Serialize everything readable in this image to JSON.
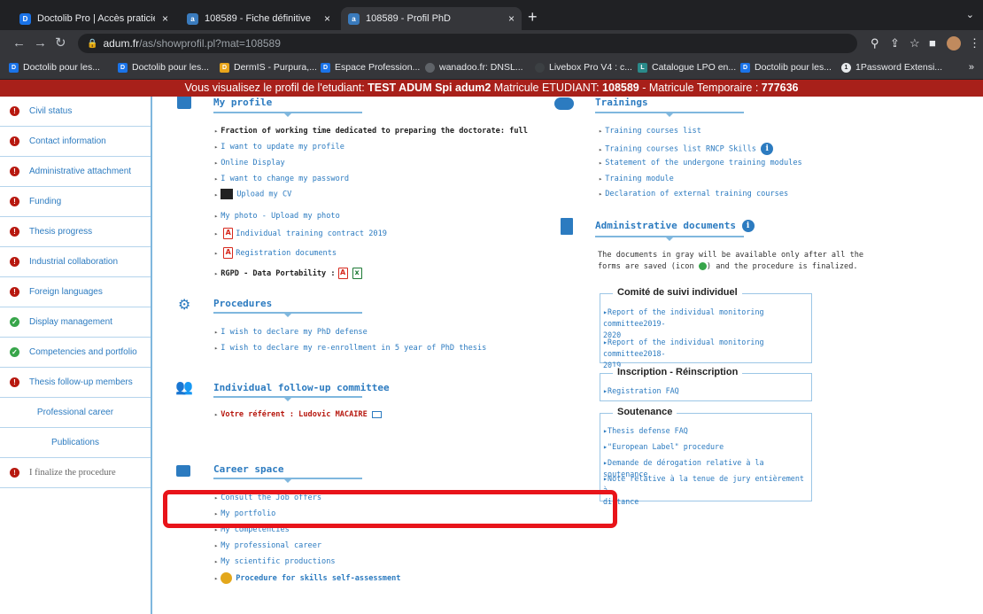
{
  "browser": {
    "tabs": [
      {
        "title": "Doctolib Pro | Accès praticiens",
        "active": false
      },
      {
        "title": "108589 - Fiche définitive",
        "active": false
      },
      {
        "title": "108589 - Profil PhD",
        "active": true
      }
    ],
    "url_host": "adum.fr",
    "url_path": "/as/showprofil.pl?mat=108589",
    "bookmarks": [
      "Doctolib pour les...",
      "Doctolib pour les...",
      "DermIS - Purpura,...",
      "Espace Profession...",
      "wanadoo.fr: DNSL...",
      "Livebox Pro V4 : c...",
      "Catalogue LPO en...",
      "Doctolib pour les...",
      "1Password Extensi..."
    ]
  },
  "banner": {
    "prefix": "Vous visualisez le profil de l'etudiant:",
    "student": "TEST ADUM Spi adum2",
    "matricule_label": "Matricule ETUDIANT:",
    "matricule": "108589",
    "temp_label": "- Matricule Temporaire :",
    "temp": "777636"
  },
  "sidebar": {
    "items": [
      {
        "label": "Civil status",
        "status": "red"
      },
      {
        "label": "Contact information",
        "status": "red"
      },
      {
        "label": "Administrative attachment",
        "status": "red"
      },
      {
        "label": "Funding",
        "status": "red"
      },
      {
        "label": "Thesis progress",
        "status": "red"
      },
      {
        "label": "Industrial collaboration",
        "status": "red"
      },
      {
        "label": "Foreign languages",
        "status": "red"
      },
      {
        "label": "Display management",
        "status": "green"
      },
      {
        "label": "Competencies and portfolio",
        "status": "green"
      },
      {
        "label": "Thesis follow-up members",
        "status": "red"
      },
      {
        "label": "Professional career",
        "status": "none"
      },
      {
        "label": "Publications",
        "status": "none"
      },
      {
        "label": "I finalize the procedure",
        "status": "red"
      }
    ]
  },
  "profile": {
    "title": "My profile",
    "fraction": "Fraction of working time dedicated to preparing the doctorate: full",
    "links": [
      "I want to update my profile",
      "Online Display",
      "I want to change my password"
    ],
    "upload_cv": "Upload my CV",
    "photo": "My photo - Upload my photo",
    "contract": "Individual training contract 2019",
    "registration": "Registration documents",
    "rgpd": "RGPD - Data Portability :"
  },
  "procedures": {
    "title": "Procedures",
    "links": [
      "I wish to declare my PhD defense",
      "I wish to declare my re-enrollment in 5 year of PhD thesis"
    ]
  },
  "committee": {
    "title": "Individual follow-up committee",
    "referent": "Votre référent : Ludovic MACAIRE"
  },
  "career": {
    "title": "Career space",
    "links": [
      "Consult the Job offers",
      "My portfolio",
      "My competencies",
      "My professional career",
      "My scientific productions"
    ],
    "skills": "Procedure for skills self-assessment"
  },
  "trainings": {
    "title": "Trainings",
    "links": [
      "Training courses list",
      "Training courses list RNCP Skills",
      "Statement of the undergone training modules",
      "Training module",
      "Declaration of external training courses"
    ]
  },
  "admin_docs": {
    "title": "Administrative documents",
    "note_1": "The documents in gray will be available only after all the",
    "note_2a": "forms are saved (icon",
    "note_2b": ") and the procedure is finalized.",
    "comite": {
      "legend": "Comité de suivi individuel",
      "link1_a": "Report of the individual monitoring committee2019-",
      "link1_b": "2020",
      "link2_a": "Report of the individual monitoring committee2018-",
      "link2_b": "2019"
    },
    "inscription": {
      "legend": "Inscription - Réinscription",
      "link": "Registration FAQ"
    },
    "soutenance": {
      "legend": "Soutenance",
      "links": [
        "Thesis defense FAQ",
        "\"European Label\" procedure",
        "Demande de dérogation relative à la soutenance"
      ],
      "last_a": "Note relative à la tenue de jury entièrement à",
      "last_b": "distance"
    }
  },
  "colors": {
    "accent": "#2c7bc0",
    "banner": "#a8201a",
    "error": "#b7180f",
    "ok": "#37a54a",
    "highlight": "#e8141a"
  }
}
